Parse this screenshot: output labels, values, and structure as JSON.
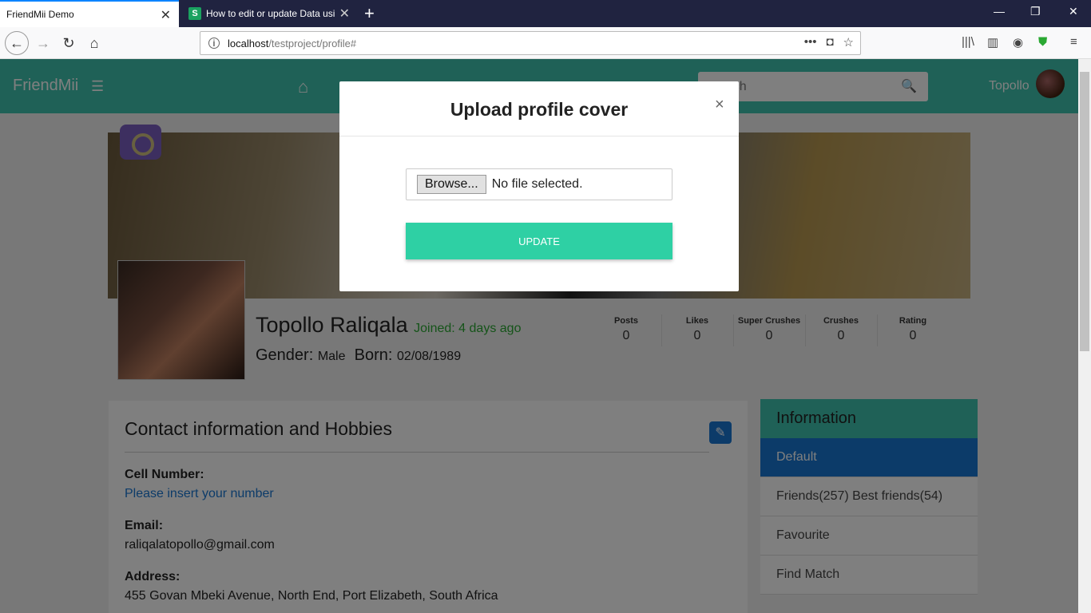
{
  "browser": {
    "tabs": [
      {
        "title": "FriendMii Demo",
        "active": true
      },
      {
        "title": "How to edit or update Data usi",
        "active": false,
        "favicon": "S"
      }
    ],
    "url_host": "localhost",
    "url_path": "/testproject/profile#"
  },
  "site": {
    "brand": "FriendMii",
    "search_placeholder": "Search",
    "username": "Topollo",
    "accent": "#3ec3ae"
  },
  "profile": {
    "name": "Topollo Raliqala",
    "joined": "Joined: 4 days ago",
    "gender_label": "Gender:",
    "gender_value": "Male",
    "born_label": "Born:",
    "born_value": "02/08/1989",
    "stats": [
      {
        "label": "Posts",
        "value": "0"
      },
      {
        "label": "Likes",
        "value": "0"
      },
      {
        "label": "Super Crushes",
        "value": "0"
      },
      {
        "label": "Crushes",
        "value": "0"
      },
      {
        "label": "Rating",
        "value": "0"
      }
    ]
  },
  "contact": {
    "title": "Contact information and Hobbies",
    "cell_label": "Cell Number:",
    "cell_value": "Please insert your number",
    "email_label": "Email:",
    "email_value": "raliqalatopollo@gmail.com",
    "address_label": "Address:",
    "address_value": "455 Govan Mbeki Avenue, North End, Port Elizabeth, South Africa"
  },
  "info_panel": {
    "title": "Information",
    "items": [
      "Default",
      "Friends(257) Best friends(54)",
      "Favourite",
      "Find Match"
    ]
  },
  "modal": {
    "title": "Upload profile cover",
    "close": "×",
    "browse_label": "Browse...",
    "file_status": "No file selected.",
    "update_label": "UPDATE"
  }
}
